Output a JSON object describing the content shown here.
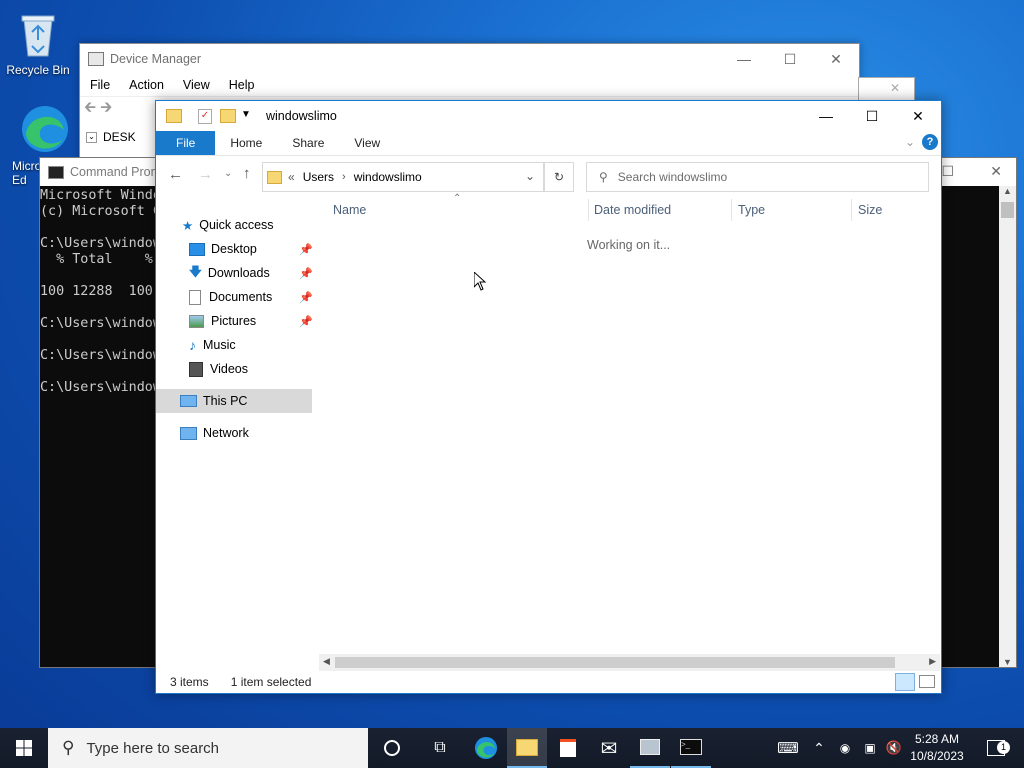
{
  "desktop": {
    "icons": [
      {
        "label": "Recycle Bin"
      },
      {
        "label": "Micro Ed"
      }
    ]
  },
  "device_manager": {
    "title": "Device Manager",
    "menu": [
      "File",
      "Action",
      "View",
      "Help"
    ],
    "tree_partial": "DESK"
  },
  "cmd": {
    "title": "Command Prompt",
    "lines": [
      "Microsoft Windo",
      "(c) Microsoft C",
      "",
      "C:\\Users\\window",
      "  % Total    %",
      "",
      "100 12288  100",
      "",
      "C:\\Users\\window",
      "",
      "C:\\Users\\window",
      "",
      "C:\\Users\\window"
    ]
  },
  "explorer": {
    "title": "windowslimo",
    "ribbon_tabs": [
      "File",
      "Home",
      "Share",
      "View"
    ],
    "address": {
      "prefix": "«",
      "crumbs": [
        "Users",
        "windowslimo"
      ]
    },
    "search_placeholder": "Search windowslimo",
    "nav": {
      "quick_access": "Quick access",
      "items": [
        {
          "label": "Desktop",
          "pinned": true
        },
        {
          "label": "Downloads",
          "pinned": true
        },
        {
          "label": "Documents",
          "pinned": true
        },
        {
          "label": "Pictures",
          "pinned": true
        },
        {
          "label": "Music",
          "pinned": false
        },
        {
          "label": "Videos",
          "pinned": false
        }
      ],
      "this_pc": "This PC",
      "network": "Network"
    },
    "columns": [
      "Name",
      "Date modified",
      "Type",
      "Size"
    ],
    "loading_text": "Working on it...",
    "status": {
      "items": "3 items",
      "selected": "1 item selected"
    }
  },
  "taskbar": {
    "search_placeholder": "Type here to search",
    "time": "5:28 AM",
    "date": "10/8/2023",
    "notification_count": "1"
  },
  "colors": {
    "accent": "#1979ca",
    "selection": "#cce8ff",
    "thispc_bg": "#d9d9d9"
  }
}
